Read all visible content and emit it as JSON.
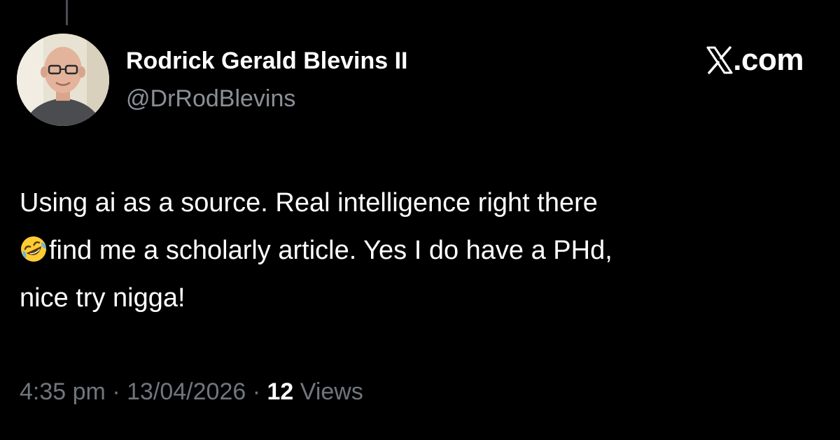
{
  "post": {
    "author_name": "Rodrick Gerald Blevins II",
    "author_handle": "@DrRodBlevins",
    "text_before_emoji": "Using ai as a source. Real intelligence right there\n",
    "emoji": "rolling-on-floor-laughing",
    "text_after_emoji": "find me a scholarly article. Yes I do have a PHd,\nnice try nigga!",
    "time": "4:35 pm",
    "date": "13/04/2026",
    "separator": "·",
    "views_count": "12",
    "views_label": "Views"
  },
  "brand": {
    "text": ".com",
    "icon": "x-logo-icon"
  },
  "colors": {
    "background": "#000000",
    "primary_text": "#ffffff",
    "secondary_text": "#8b9096",
    "meta_text": "#70767c"
  }
}
